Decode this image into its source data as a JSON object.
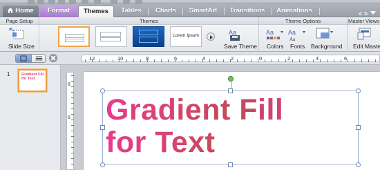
{
  "tabs": {
    "home": "Home",
    "format": "Format",
    "themes": "Themes",
    "tables": "Tables",
    "charts": "Charts",
    "smartart": "SmartArt",
    "transitions": "Transitions",
    "animations": "Animations",
    "more": "< >"
  },
  "ribbon": {
    "groups": {
      "page_setup": "Page Setup",
      "themes": "Themes",
      "theme_options": "Theme Options",
      "master_views": "Master Views"
    },
    "slide_size_label": "Slide Size",
    "lorem_ipsum": "Lorem Ipsum",
    "save_theme_label": "Save Theme",
    "colors_label": "Colors",
    "fonts_label": "Fonts",
    "background_label": "Background",
    "edit_master_label": "Edit Master",
    "aa_glyph": "Aa"
  },
  "ruler": {
    "h_numbers": [
      "12",
      "10",
      "8",
      "6",
      "4",
      "2",
      "0",
      "2",
      "4",
      "6"
    ],
    "v_numbers": [
      "8",
      "6"
    ]
  },
  "slides_pane": {
    "slide_number": "1",
    "thumb_text": "Gradient Fill for Text"
  },
  "slide": {
    "text": "Gradient Fill\nfor Text"
  },
  "colors": {
    "format_tab": "#a777d3",
    "selection_orange": "#f09a3c",
    "gradient_pink": "#e83b8c",
    "gradient_red": "#c24a5a",
    "rotation_handle": "#6ec25a"
  }
}
